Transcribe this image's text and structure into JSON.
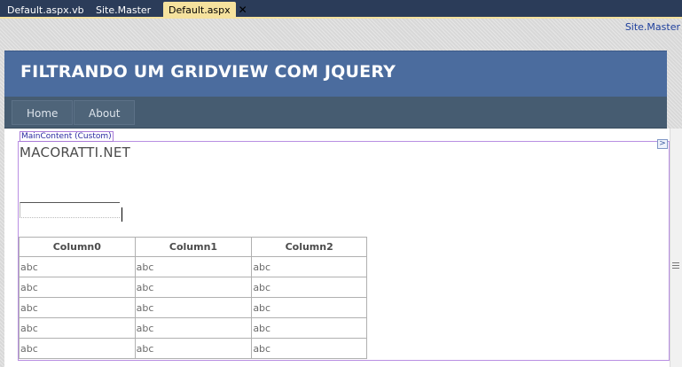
{
  "tabs": [
    {
      "label": "Default.aspx.vb",
      "active": false
    },
    {
      "label": "Site.Master",
      "active": false
    },
    {
      "label": "Default.aspx",
      "active": true
    }
  ],
  "close_glyph": "✕",
  "master_link": "Site.Master",
  "header": {
    "title": "FILTRANDO UM GRIDVIEW COM JQUERY"
  },
  "menu": [
    {
      "label": "Home"
    },
    {
      "label": "About"
    }
  ],
  "main_content_label": "MainContent (Custom)",
  "page_heading": "MACORATTI.NET",
  "filter": {
    "value": ""
  },
  "grid": {
    "columns": [
      "Column0",
      "Column1",
      "Column2"
    ],
    "rows": [
      [
        "abc",
        "abc",
        "abc"
      ],
      [
        "abc",
        "abc",
        "abc"
      ],
      [
        "abc",
        "abc",
        "abc"
      ],
      [
        "abc",
        "abc",
        "abc"
      ],
      [
        "abc",
        "abc",
        "abc"
      ]
    ]
  }
}
